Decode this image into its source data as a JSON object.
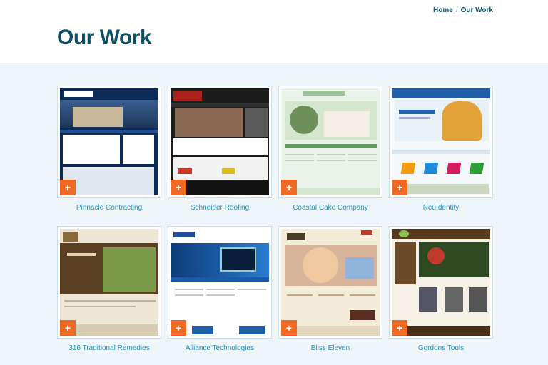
{
  "breadcrumb": {
    "home": "Home",
    "separator": "/",
    "current": "Our Work"
  },
  "page": {
    "title": "Our Work"
  },
  "portfolio": {
    "items": [
      {
        "name": "Pinnacle Contracting",
        "badge": "+"
      },
      {
        "name": "Schneider Roofing",
        "badge": "+"
      },
      {
        "name": "Coastal Cake Company",
        "badge": "+"
      },
      {
        "name": "NeuIdentity",
        "badge": "+"
      },
      {
        "name": "316 Traditional Remedies",
        "badge": "+"
      },
      {
        "name": "Alliance Technologies",
        "badge": "+"
      },
      {
        "name": "Bliss Eleven",
        "badge": "+"
      },
      {
        "name": "Gordons Tools",
        "badge": "+"
      }
    ]
  },
  "colors": {
    "accent": "#ef6a24",
    "title": "#0f4f66",
    "link": "#2a93b5",
    "background": "#eef5f9"
  }
}
